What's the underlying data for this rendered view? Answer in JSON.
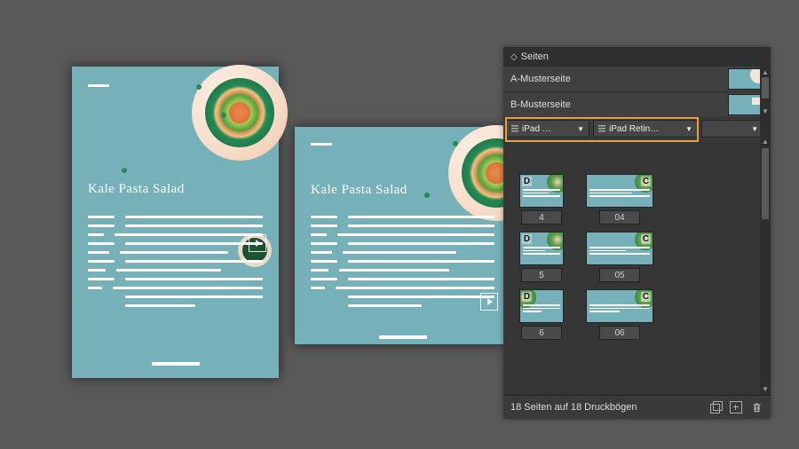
{
  "document": {
    "recipe_title": "Kale Pasta Salad"
  },
  "panel": {
    "title": "Seiten",
    "masters": [
      "A-Musterseite",
      "B-Musterseite"
    ],
    "layout_dropdowns": {
      "a": "iPad …",
      "b": "iPad Retin…"
    },
    "thumbs": [
      {
        "badge": "D",
        "num": "4"
      },
      {
        "badge": "C",
        "num": "04"
      },
      {
        "badge": "D",
        "num": "5"
      },
      {
        "badge": "C",
        "num": "05"
      },
      {
        "badge": "D",
        "num": "6"
      },
      {
        "badge": "C",
        "num": "06"
      }
    ],
    "footer_status": "18 Seiten auf 18 Druckbögen"
  }
}
